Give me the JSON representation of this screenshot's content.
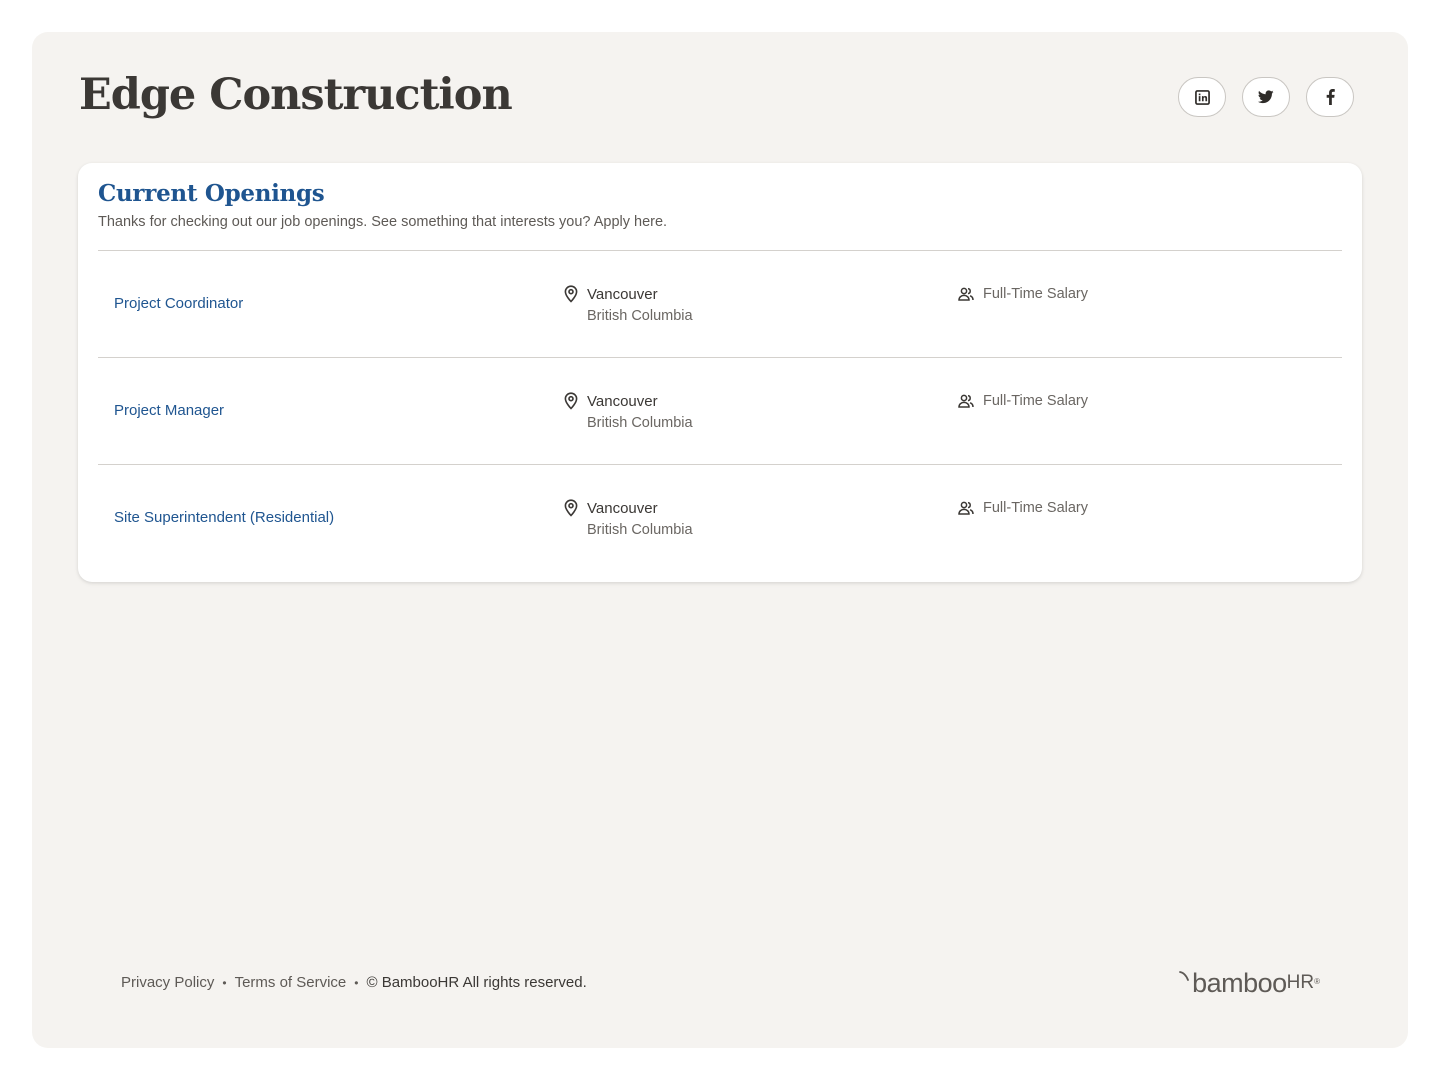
{
  "company": {
    "name": "Edge Construction"
  },
  "social": [
    {
      "name": "linkedin",
      "icon": "linkedin-icon"
    },
    {
      "name": "twitter",
      "icon": "twitter-icon"
    },
    {
      "name": "facebook",
      "icon": "facebook-icon"
    }
  ],
  "openings": {
    "title": "Current Openings",
    "subtitle": "Thanks for checking out our job openings. See something that interests you? Apply here.",
    "jobs": [
      {
        "title": "Project Coordinator",
        "city": "Vancouver",
        "region": "British Columbia",
        "type": "Full-Time Salary"
      },
      {
        "title": "Project Manager",
        "city": "Vancouver",
        "region": "British Columbia",
        "type": "Full-Time Salary"
      },
      {
        "title": "Site Superintendent (Residential)",
        "city": "Vancouver",
        "region": "British Columbia",
        "type": "Full-Time Salary"
      }
    ]
  },
  "footer": {
    "privacy": "Privacy Policy",
    "terms": "Terms of Service",
    "separator": "•",
    "copyright": "© BambooHR All rights reserved.",
    "brand_word": "bamboo",
    "brand_hr": "HR",
    "brand_tm": "®"
  },
  "colors": {
    "link": "#1f5590",
    "title": "#3b3835",
    "background": "#f5f3f0"
  }
}
